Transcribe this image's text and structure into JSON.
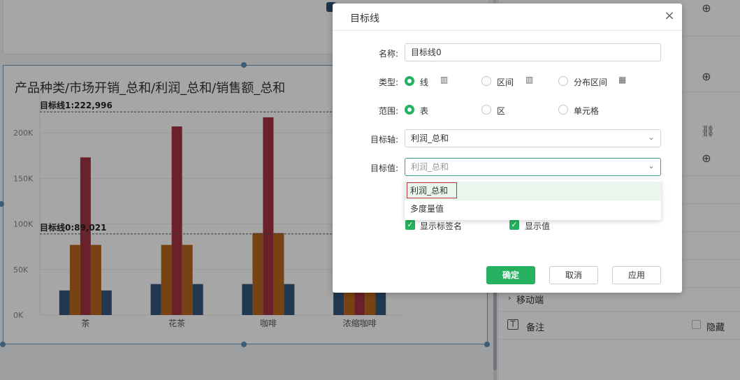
{
  "chart": {
    "title": "产品种类/市场开销_总和/利润_总和/销售额_总和",
    "target_line_1": "目标线1:222,996",
    "target_line_0": "目标线0:89,021"
  },
  "chart_data": {
    "type": "bar",
    "title": "产品种类/市场开销_总和/利润_总和/销售额_总和",
    "categories": [
      "茶",
      "花茶",
      "咖啡",
      "浓缩咖啡"
    ],
    "y_ticks": [
      "200K",
      "150K",
      "100K",
      "50K",
      "0K"
    ],
    "ylim": [
      0,
      230000
    ],
    "series": [
      {
        "color": "#34567b",
        "values": [
          27000,
          34000,
          34000,
          38000
        ]
      },
      {
        "color": "#b8671e",
        "values": [
          77000,
          77000,
          90000,
          28000
        ]
      },
      {
        "color": "#a3343f",
        "values": [
          173000,
          207000,
          217000,
          28000
        ]
      },
      {
        "color": "#b8671e",
        "values": [
          77000,
          77000,
          90000,
          28000
        ]
      },
      {
        "color": "#34567b",
        "values": [
          27000,
          34000,
          34000,
          38000
        ]
      }
    ],
    "reference_lines": [
      {
        "label": "目标线1:222,996",
        "value": 222996
      },
      {
        "label": "目标线0:89,021",
        "value": 89021
      }
    ],
    "grid": true,
    "legend": "none"
  },
  "panel": {
    "move_label": "移动端",
    "note_label": "备注",
    "hide_label": "隐藏"
  },
  "dialog": {
    "title": "目标线",
    "name_label": "名称:",
    "name_value": "目标线0",
    "type_label": "类型:",
    "type_options": [
      "线",
      "区间",
      "分布区间"
    ],
    "range_label": "范围:",
    "range_options": [
      "表",
      "区",
      "单元格"
    ],
    "axis_label": "目标轴:",
    "axis_value": "利润_总和",
    "value_label": "目标值:",
    "value_placeholder": "利润_总和",
    "dropdown_items": [
      "利润_总和",
      "多度量值"
    ],
    "show_tag_name": "显示标签名",
    "show_value": "显示值",
    "ok": "确定",
    "cancel": "取消",
    "apply": "应用"
  }
}
